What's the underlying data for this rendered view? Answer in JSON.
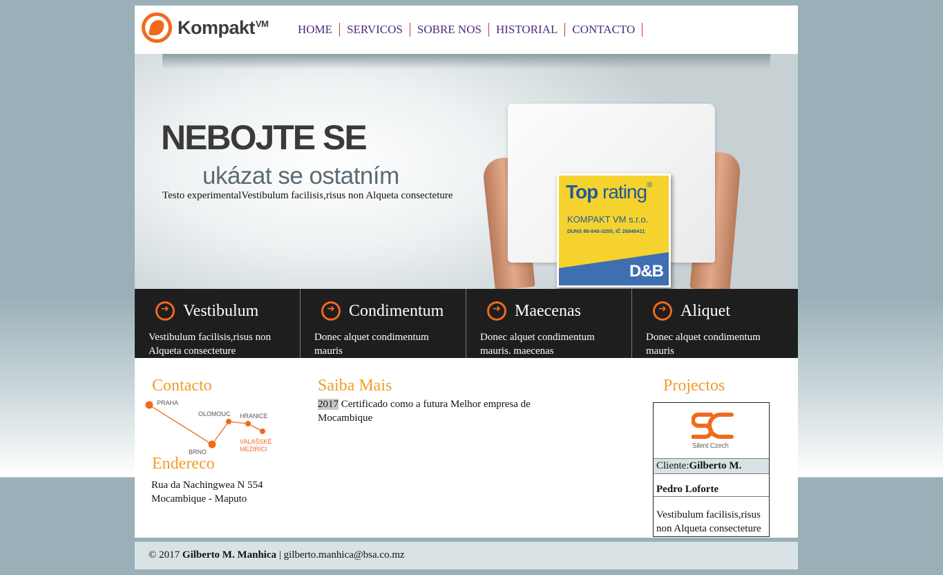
{
  "header": {
    "logo_text": "Kompakt",
    "logo_sup": "VM",
    "nav": [
      "HOME",
      "SERVICOS",
      "SOBRE NOS",
      "HISTORIAL",
      "CONTACTO"
    ]
  },
  "hero": {
    "title": "NEBOJTE SE",
    "subtitle": "ukázat se ostatním",
    "text": "Testo experimentalVestibulum facilisis,risus non Alqueta consecteture",
    "badge": {
      "title_bold": "Top",
      "title_rest": " rating",
      "reg": "®",
      "company": "KOMPAKT VM s.r.o.",
      "duns": "DUNS 88-840-3255, IČ 26849411",
      "db": "D&B"
    }
  },
  "features": [
    {
      "title": "Vestibulum",
      "text": "Vestibulum facilisis,risus non Alqueta consecteture"
    },
    {
      "title": "Condimentum",
      "text": "Donec alquet condimentum mauris"
    },
    {
      "title": "Maecenas",
      "text": "Donec alquet condimentum mauris. maecenas"
    },
    {
      "title": "Aliquet",
      "text": "Donec alquet condimentum mauris"
    }
  ],
  "contact": {
    "title": "Contacto",
    "map_labels": [
      "PRAHA",
      "OLOMOUC",
      "HRANICE",
      "BRNO",
      "VALAŠSKÉ",
      "MEZIRICI"
    ],
    "address_title": "Endereco",
    "address_line1": "Rua da Nachingwea N 554",
    "address_line2": "Mocambique - Maputo"
  },
  "saiba": {
    "title": "Saiba Mais",
    "year": "2017",
    "text": " Certificado como a futura Melhor empresa de Mocambique"
  },
  "projects": {
    "title": "Projectos",
    "logo_caption": "Silent Czech",
    "client_label": "Cliente:",
    "client_name": "Gilberto M.",
    "client_name2": "Pedro Loforte",
    "description": "Vestibulum facilisis,risus non Alqueta consecteture"
  },
  "footer": {
    "copyright": "© 2017 ",
    "author": "Gilberto M. Manhica",
    "separator": " | ",
    "email": "gilberto.manhica@bsa.co.mz"
  },
  "colors": {
    "accent_orange": "#f06a1c",
    "heading_orange": "#f39c2a",
    "nav_purple": "#4b2a7e",
    "feature_bg": "#1e1e1e",
    "page_bg": "#9ab0b8"
  }
}
